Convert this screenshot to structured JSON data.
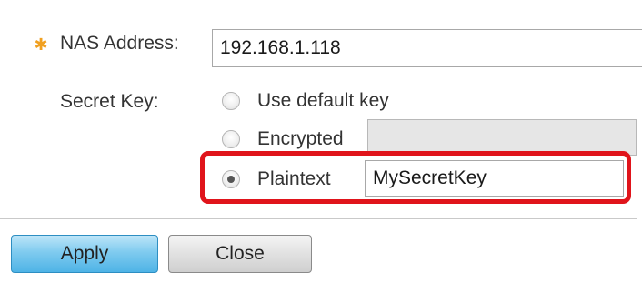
{
  "form": {
    "nas_address": {
      "label": "NAS Address:",
      "value": "192.168.1.118"
    },
    "secret_key": {
      "label": "Secret Key:",
      "options": [
        {
          "label": "Use default key",
          "selected": false
        },
        {
          "label": "Encrypted",
          "selected": false,
          "value": ""
        },
        {
          "label": "Plaintext",
          "selected": true,
          "value": "MySecretKey"
        }
      ]
    }
  },
  "buttons": {
    "apply_label": "Apply",
    "close_label": "Close"
  },
  "colors": {
    "required_icon": "#f0a020",
    "highlight": "#e0141b",
    "apply_button": "#4eb3e6"
  },
  "icons": {
    "required": "gear-icon"
  }
}
